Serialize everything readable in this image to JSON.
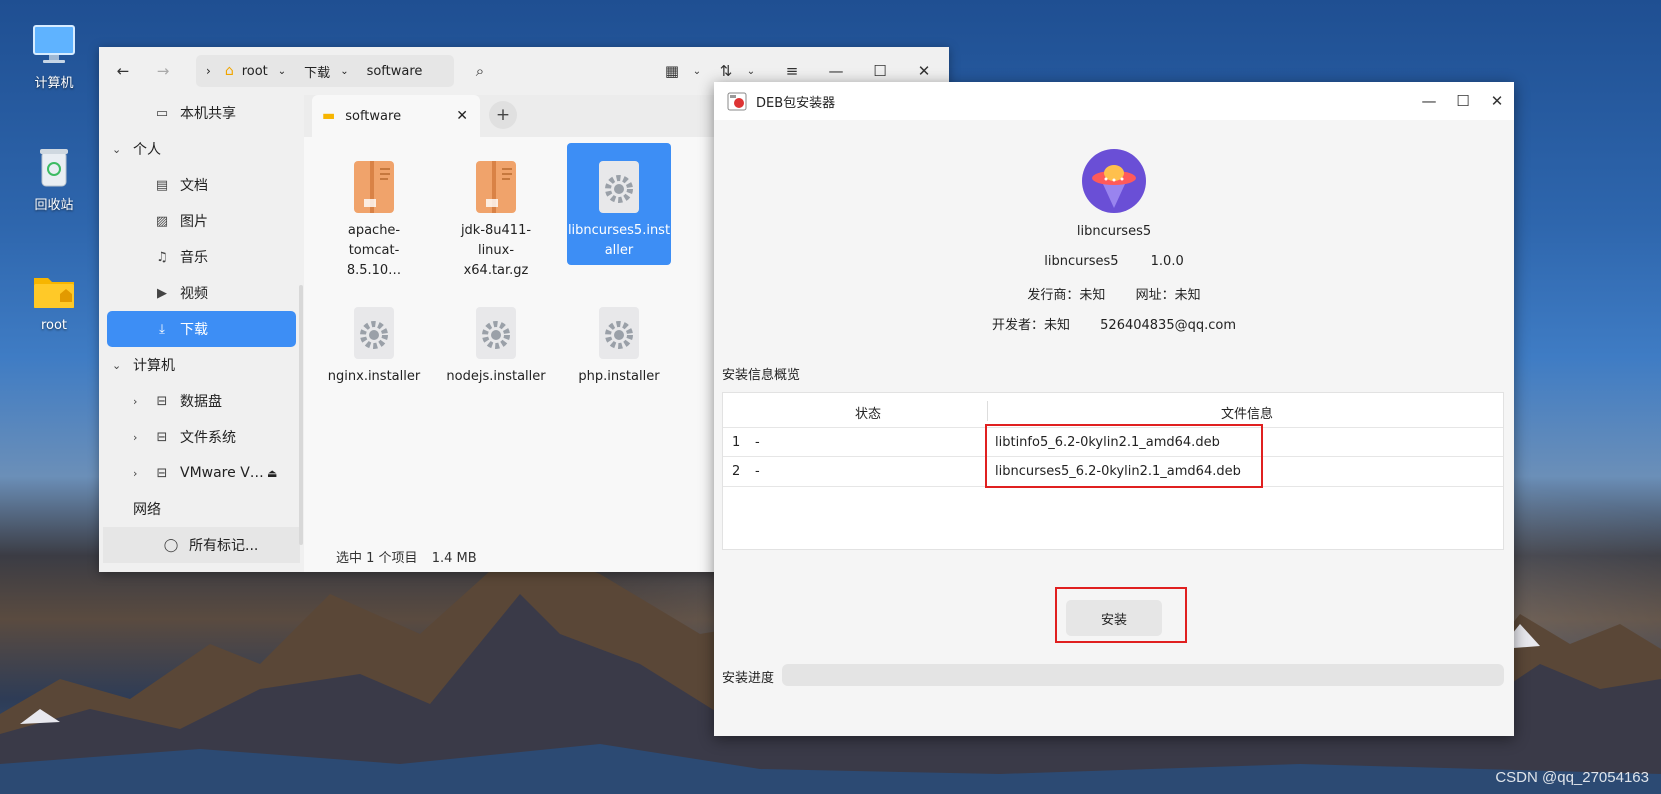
{
  "desktop": {
    "icons": [
      {
        "label": "计算机"
      },
      {
        "label": "回收站"
      },
      {
        "label": "root"
      }
    ],
    "watermark": "CSDN @qq_27054163"
  },
  "file_manager": {
    "breadcrumb": [
      "root",
      "下载",
      "software"
    ],
    "sidebar": {
      "shared": "本机共享",
      "personal": "个人",
      "documents": "文档",
      "pictures": "图片",
      "music": "音乐",
      "videos": "视频",
      "downloads": "下载",
      "computer": "计算机",
      "data_disk": "数据盘",
      "filesystem": "文件系统",
      "vmware": "VMware V…",
      "network": "网络",
      "all_tags": "所有标记..."
    },
    "tab": {
      "label": "software"
    },
    "files": [
      {
        "name_l1": "apache-",
        "name_l2": "tomcat-8.5.10…"
      },
      {
        "name_l1": "jdk-8u411-linux-",
        "name_l2": "x64.tar.gz"
      },
      {
        "name_l1": "libncurses5.inst",
        "name_l2": "aller"
      },
      {
        "name_l1": "nginx.installer",
        "name_l2": ""
      },
      {
        "name_l1": "nodejs.installer",
        "name_l2": ""
      },
      {
        "name_l1": "php.installer",
        "name_l2": ""
      }
    ],
    "status": {
      "selected": "选中 1 个项目",
      "size": "1.4 MB"
    }
  },
  "deb_installer": {
    "title": "DEB包安装器",
    "package_name": "libncurses5",
    "package_line_name": "libncurses5",
    "version": "1.0.0",
    "publisher": "发行商：未知",
    "website": "网址：未知",
    "developer": "开发者：未知",
    "email": "526404835@qq.com",
    "overview_label": "安装信息概览",
    "table": {
      "headers": [
        "状态",
        "文件信息"
      ],
      "rows": [
        {
          "num": "1",
          "status": "-",
          "file": "libtinfo5_6.2-0kylin2.1_amd64.deb"
        },
        {
          "num": "2",
          "status": "-",
          "file": "libncurses5_6.2-0kylin2.1_amd64.deb"
        }
      ]
    },
    "install_label": "安装",
    "progress_label": "安装进度",
    "progress_value": 0
  },
  "colors": {
    "accent": "#3d8ef5",
    "highlight_box": "#e02020"
  }
}
